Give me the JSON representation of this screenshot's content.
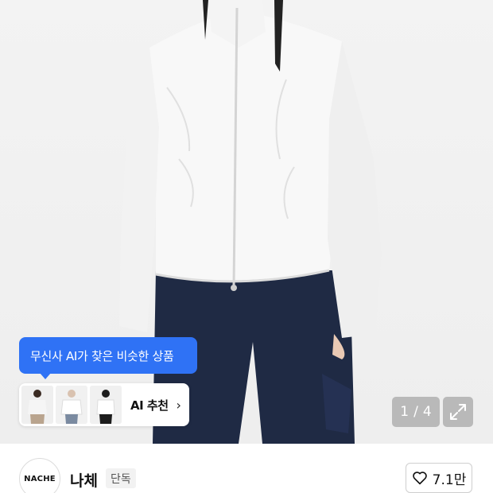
{
  "ai_tooltip": {
    "text": "무신사 AI가 찾은 비슷한 상품"
  },
  "ai_card": {
    "label": "AI 추천",
    "chevron": "›"
  },
  "gallery": {
    "current": "1",
    "separator": "/",
    "total": "4"
  },
  "brand": {
    "logo_text": "NACHE",
    "name": "나체",
    "badge": "단독"
  },
  "like": {
    "count": "7.1만",
    "icon": "heart-outline-icon"
  },
  "colors": {
    "accent": "#2f72f5",
    "jacket": "#f7f7f7",
    "pants": "#1f2a44"
  }
}
